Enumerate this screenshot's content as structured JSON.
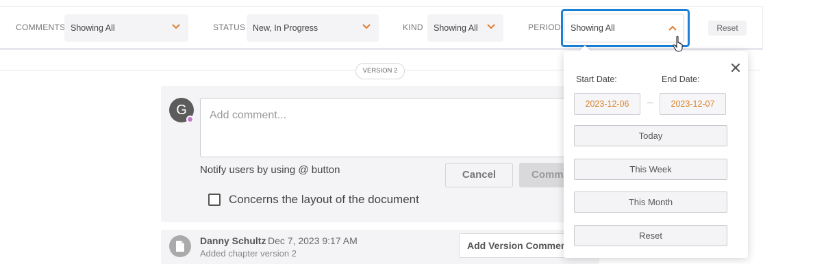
{
  "filters": {
    "comments": {
      "label": "COMMENTS",
      "value": "Showing All"
    },
    "status": {
      "label": "STATUS",
      "value": "New, In Progress"
    },
    "kind": {
      "label": "KIND",
      "value": "Showing All"
    },
    "period": {
      "label": "PERIOD",
      "value": "Showing All"
    },
    "reset_label": "Reset"
  },
  "version_label": "VERSION 2",
  "composer": {
    "avatar_initial": "G",
    "placeholder": "Add comment...",
    "notify_text": "Notify users by using @ button",
    "cancel_label": "Cancel",
    "comment_label": "Comment",
    "layout_checkbox_label": "Concerns the layout of the document"
  },
  "history": {
    "author": "Danny Schultz",
    "date": "Dec 7, 2023 9:17 AM",
    "description": "Added chapter version 2",
    "add_version_comment_label": "Add Version Comment"
  },
  "period_popover": {
    "start_label": "Start Date:",
    "end_label": "End Date:",
    "start_date": "2023-12-06",
    "end_date": "2023-12-07",
    "buttons": [
      "Today",
      "This Week",
      "This Month",
      "Reset"
    ]
  },
  "colors": {
    "accent_orange": "#e07b2a",
    "focus_blue": "#1b7fd6",
    "date_text": "#d9822b",
    "presence_dot": "#c779c9"
  }
}
